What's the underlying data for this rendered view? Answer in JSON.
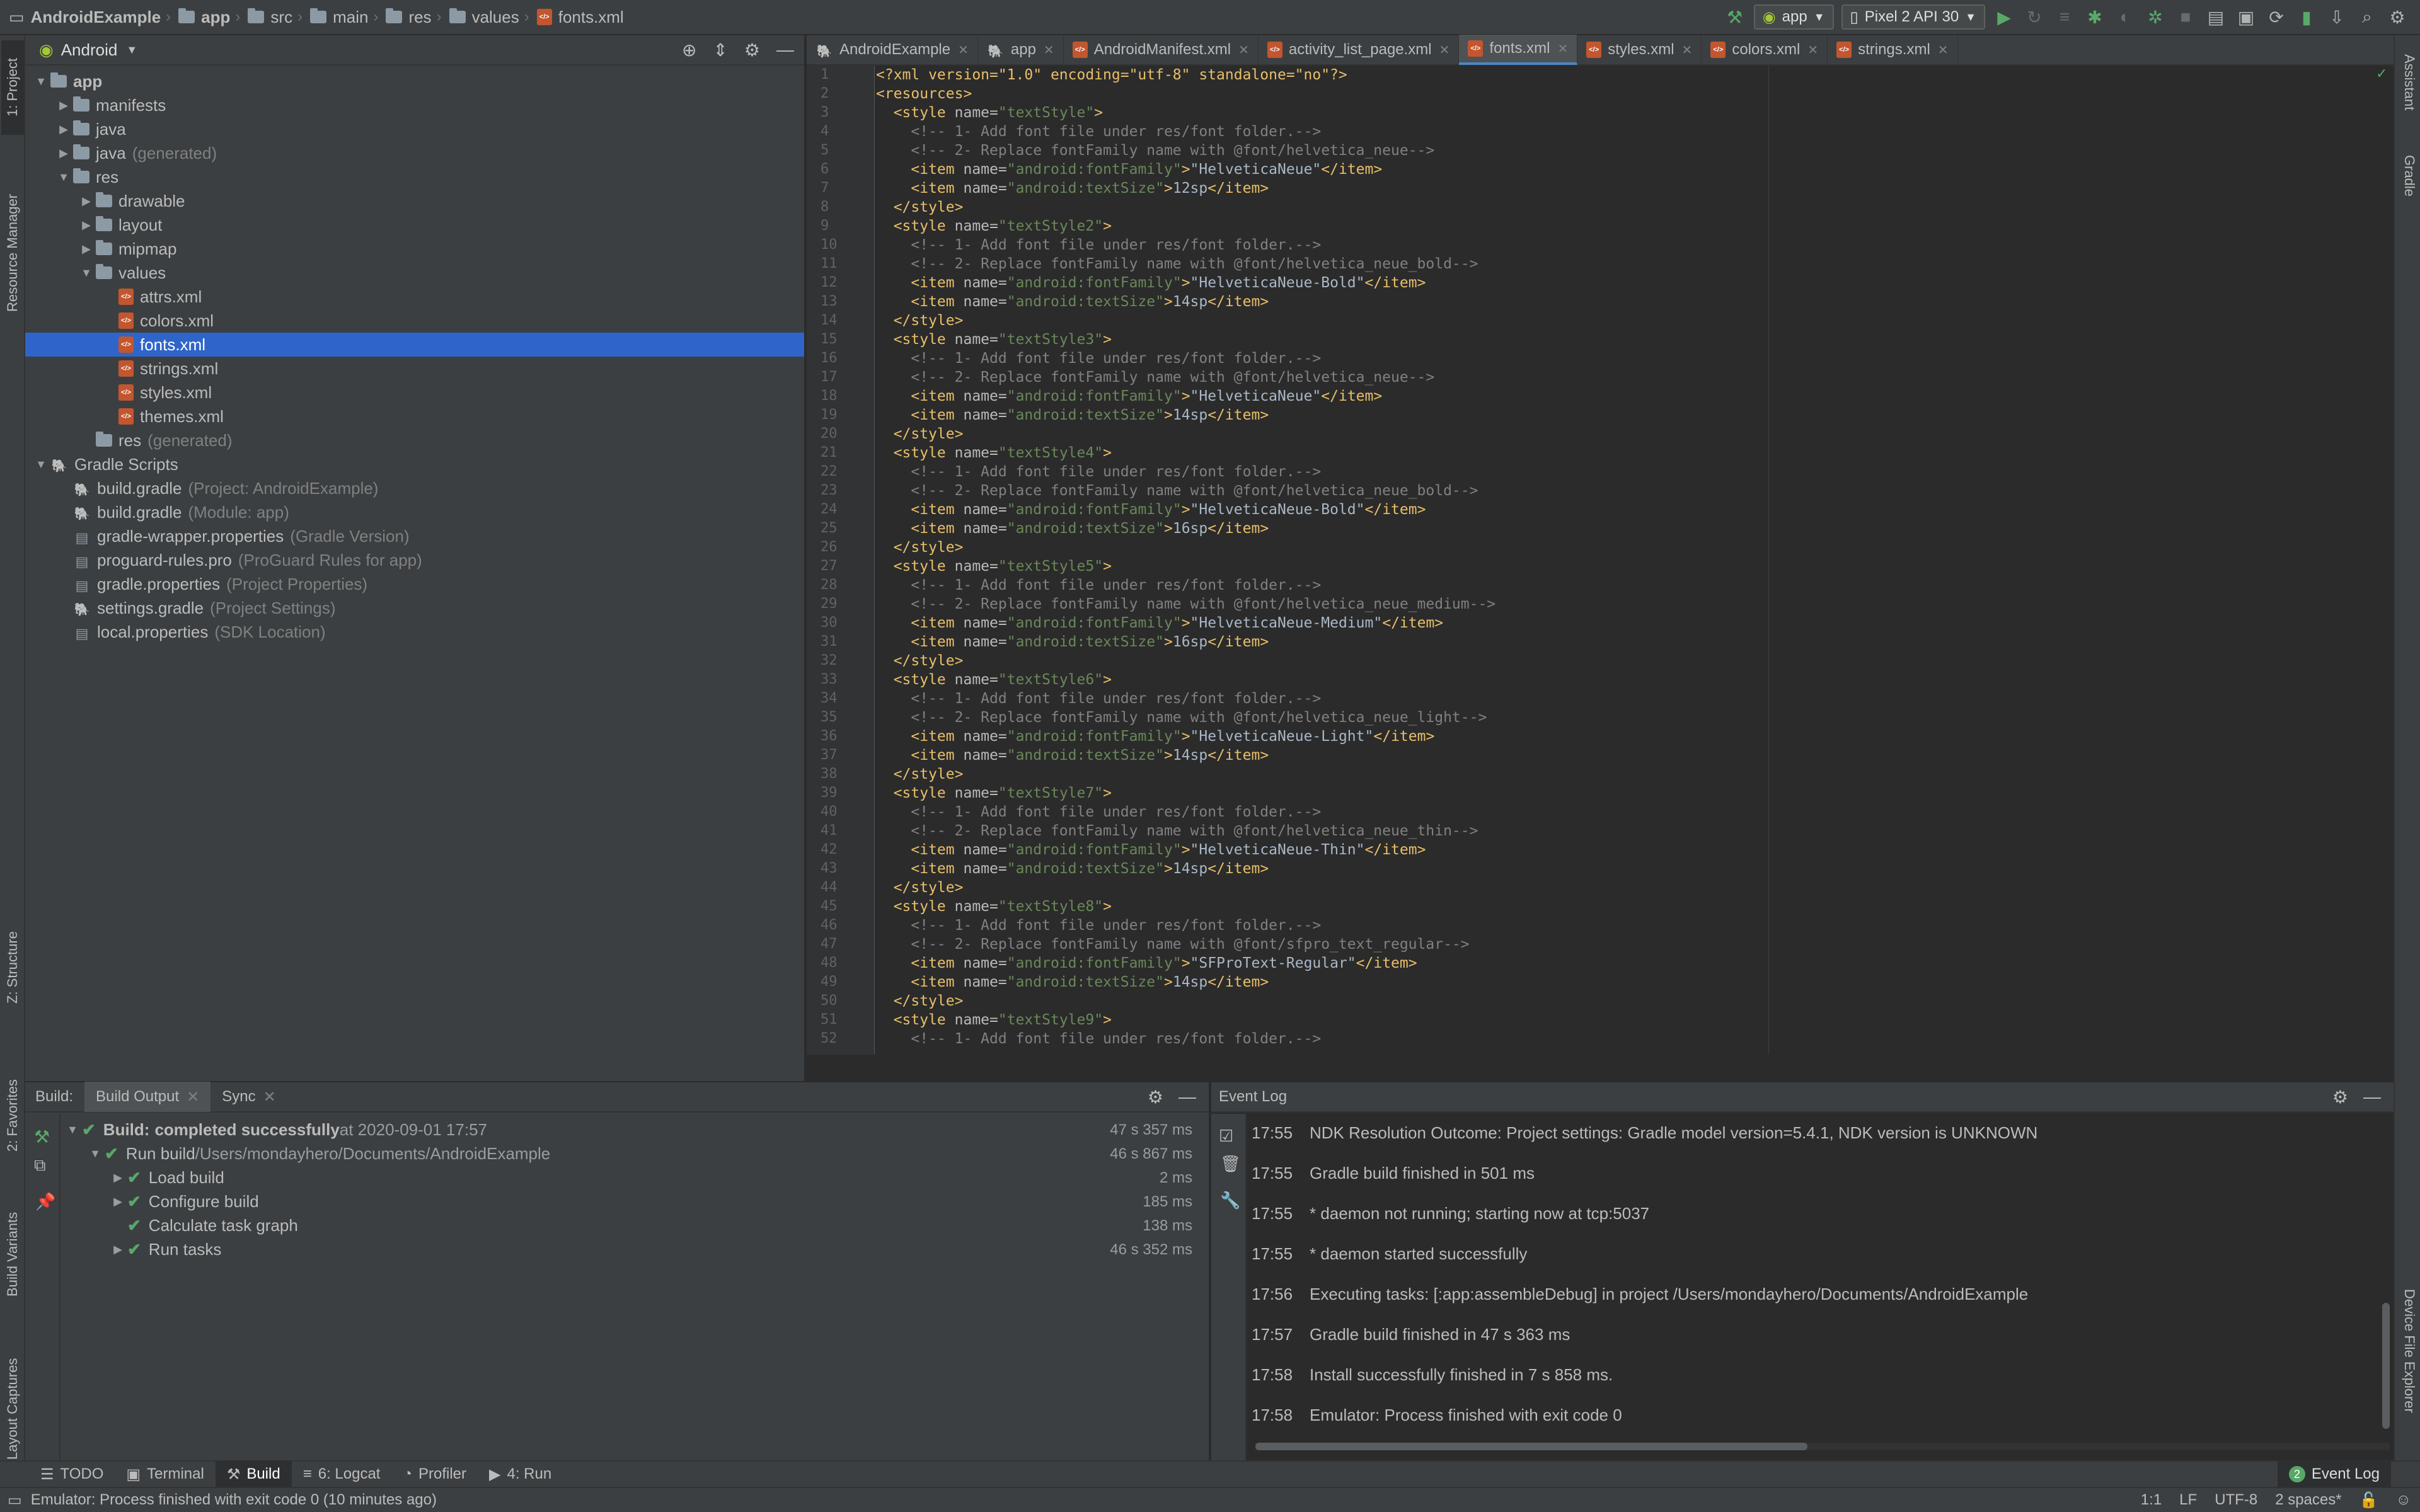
{
  "breadcrumbs": [
    "AndroidExample",
    "app",
    "src",
    "main",
    "res",
    "values",
    "fonts.xml"
  ],
  "run_config": "app",
  "device": "Pixel 2 API 30",
  "project_view": "Android",
  "left_stripe": {
    "project": "1: Project",
    "resource_manager": "Resource Manager",
    "structure": "Z: Structure",
    "favorites": "2: Favorites",
    "build_variants": "Build Variants",
    "layout_captures": "Layout Captures"
  },
  "right_stripe": {
    "assistant": "Assistant",
    "gradle": "Gradle",
    "device_file_explorer": "Device File Explorer"
  },
  "tree": [
    {
      "label": "app",
      "hint": "",
      "indent": 0,
      "arrow": "down",
      "icon": "folder-icon",
      "bold": true
    },
    {
      "label": "manifests",
      "hint": "",
      "indent": 1,
      "arrow": "right",
      "icon": "folder-icon"
    },
    {
      "label": "java",
      "hint": "",
      "indent": 1,
      "arrow": "right",
      "icon": "folder-icon"
    },
    {
      "label": "java",
      "hint": "(generated)",
      "indent": 1,
      "arrow": "right",
      "icon": "folder-icon"
    },
    {
      "label": "res",
      "hint": "",
      "indent": 1,
      "arrow": "down",
      "icon": "folder-icon"
    },
    {
      "label": "drawable",
      "hint": "",
      "indent": 2,
      "arrow": "right",
      "icon": "folder-icon"
    },
    {
      "label": "layout",
      "hint": "",
      "indent": 2,
      "arrow": "right",
      "icon": "folder-icon"
    },
    {
      "label": "mipmap",
      "hint": "",
      "indent": 2,
      "arrow": "right",
      "icon": "folder-icon"
    },
    {
      "label": "values",
      "hint": "",
      "indent": 2,
      "arrow": "down",
      "icon": "folder-icon"
    },
    {
      "label": "attrs.xml",
      "hint": "",
      "indent": 3,
      "arrow": "",
      "icon": "xml-file-icon"
    },
    {
      "label": "colors.xml",
      "hint": "",
      "indent": 3,
      "arrow": "",
      "icon": "xml-file-icon"
    },
    {
      "label": "fonts.xml",
      "hint": "",
      "indent": 3,
      "arrow": "",
      "icon": "xml-file-icon",
      "selected": true
    },
    {
      "label": "strings.xml",
      "hint": "",
      "indent": 3,
      "arrow": "",
      "icon": "xml-file-icon"
    },
    {
      "label": "styles.xml",
      "hint": "",
      "indent": 3,
      "arrow": "",
      "icon": "xml-file-icon"
    },
    {
      "label": "themes.xml",
      "hint": "",
      "indent": 3,
      "arrow": "",
      "icon": "xml-file-icon"
    },
    {
      "label": "res",
      "hint": "(generated)",
      "indent": 2,
      "arrow": "",
      "icon": "folder-icon"
    },
    {
      "label": "Gradle Scripts",
      "hint": "",
      "indent": 0,
      "arrow": "down",
      "icon": "gradle-icon"
    },
    {
      "label": "build.gradle",
      "hint": "(Project: AndroidExample)",
      "indent": 1,
      "arrow": "",
      "icon": "gradle-icon"
    },
    {
      "label": "build.gradle",
      "hint": "(Module: app)",
      "indent": 1,
      "arrow": "",
      "icon": "gradle-icon"
    },
    {
      "label": "gradle-wrapper.properties",
      "hint": "(Gradle Version)",
      "indent": 1,
      "arrow": "",
      "icon": "properties-icon"
    },
    {
      "label": "proguard-rules.pro",
      "hint": "(ProGuard Rules for app)",
      "indent": 1,
      "arrow": "",
      "icon": "properties-icon"
    },
    {
      "label": "gradle.properties",
      "hint": "(Project Properties)",
      "indent": 1,
      "arrow": "",
      "icon": "properties-icon"
    },
    {
      "label": "settings.gradle",
      "hint": "(Project Settings)",
      "indent": 1,
      "arrow": "",
      "icon": "gradle-icon"
    },
    {
      "label": "local.properties",
      "hint": "(SDK Location)",
      "indent": 1,
      "arrow": "",
      "icon": "properties-icon"
    }
  ],
  "editor_tabs": [
    {
      "label": "AndroidExample",
      "active": false
    },
    {
      "label": "app",
      "active": false
    },
    {
      "label": "AndroidManifest.xml",
      "active": false
    },
    {
      "label": "activity_list_page.xml",
      "active": false
    },
    {
      "label": "fonts.xml",
      "active": true
    },
    {
      "label": "styles.xml",
      "active": false
    },
    {
      "label": "colors.xml",
      "active": false
    },
    {
      "label": "strings.xml",
      "active": false
    }
  ],
  "code": {
    "header": "<?xml version=\"1.0\" encoding=\"utf-8\" standalone=\"no\"?>",
    "root_open": "<resources>",
    "comment1": "<!-- 1- Add font file under res/font folder.-->",
    "styles": [
      {
        "name": "textStyle",
        "font_res": "@font/helvetica_neue",
        "family": "HelveticaNeue",
        "size": "12sp"
      },
      {
        "name": "textStyle2",
        "font_res": "@font/helvetica_neue_bold",
        "family": "HelveticaNeue-Bold",
        "size": "14sp"
      },
      {
        "name": "textStyle3",
        "font_res": "@font/helvetica_neue",
        "family": "HelveticaNeue",
        "size": "14sp"
      },
      {
        "name": "textStyle4",
        "font_res": "@font/helvetica_neue_bold",
        "family": "HelveticaNeue-Bold",
        "size": "16sp"
      },
      {
        "name": "textStyle5",
        "font_res": "@font/helvetica_neue_medium",
        "family": "HelveticaNeue-Medium",
        "size": "16sp"
      },
      {
        "name": "textStyle6",
        "font_res": "@font/helvetica_neue_light",
        "family": "HelveticaNeue-Light",
        "size": "14sp"
      },
      {
        "name": "textStyle7",
        "font_res": "@font/helvetica_neue_thin",
        "family": "HelveticaNeue-Thin",
        "size": "14sp"
      },
      {
        "name": "textStyle8",
        "font_res": "@font/sfpro_text_regular",
        "family": "SFProText-Regular",
        "size": "14sp"
      },
      {
        "name": "textStyle9",
        "font_res": "",
        "family": "",
        "size": ""
      }
    ]
  },
  "build": {
    "label": "Build:",
    "tabs": [
      "Build Output",
      "Sync"
    ],
    "rows": [
      {
        "text": "Build:",
        "bold": true,
        "rest": "completed successfully",
        "extra": " at 2020-09-01 17:57",
        "time": "47 s 357 ms",
        "indent": 0,
        "arrow": "down"
      },
      {
        "text": "Run build",
        "rest": "",
        "extra": " /Users/mondayhero/Documents/AndroidExample",
        "time": "46 s 867 ms",
        "indent": 1,
        "arrow": "down"
      },
      {
        "text": "Load build",
        "rest": "",
        "extra": "",
        "time": "2 ms",
        "indent": 2,
        "arrow": "right"
      },
      {
        "text": "Configure build",
        "rest": "",
        "extra": "",
        "time": "185 ms",
        "indent": 2,
        "arrow": "right"
      },
      {
        "text": "Calculate task graph",
        "rest": "",
        "extra": "",
        "time": "138 ms",
        "indent": 2,
        "arrow": ""
      },
      {
        "text": "Run tasks",
        "rest": "",
        "extra": "",
        "time": "46 s 352 ms",
        "indent": 2,
        "arrow": "right"
      }
    ]
  },
  "event_log": {
    "title": "Event Log",
    "entries": [
      {
        "time": "17:55",
        "msg": "NDK Resolution Outcome: Project settings: Gradle model version=5.4.1, NDK version is UNKNOWN"
      },
      {
        "time": "17:55",
        "msg": "Gradle build finished in 501 ms"
      },
      {
        "time": "17:55",
        "msg": "* daemon not running; starting now at tcp:5037"
      },
      {
        "time": "17:55",
        "msg": "* daemon started successfully"
      },
      {
        "time": "17:56",
        "msg": "Executing tasks: [:app:assembleDebug] in project /Users/mondayhero/Documents/AndroidExample"
      },
      {
        "time": "17:57",
        "msg": "Gradle build finished in 47 s 363 ms"
      },
      {
        "time": "17:58",
        "msg": "Install successfully finished in 7 s 858 ms."
      },
      {
        "time": "17:58",
        "msg": "Emulator: Process finished with exit code 0"
      }
    ]
  },
  "bottom_tabs": [
    {
      "label": "TODO",
      "icon": "list-icon",
      "active": false
    },
    {
      "label": "Terminal",
      "icon": "terminal-icon",
      "active": false
    },
    {
      "label": "Build",
      "icon": "hammer-icon",
      "active": true
    },
    {
      "label": "6: Logcat",
      "icon": "logcat-icon",
      "active": false
    },
    {
      "label": "Profiler",
      "icon": "profiler-icon",
      "active": false
    },
    {
      "label": "4: Run",
      "icon": "run-icon",
      "active": false
    }
  ],
  "event_log_badge": {
    "count": "2",
    "label": "Event Log"
  },
  "status": {
    "message": "Emulator: Process finished with exit code 0 (10 minutes ago)",
    "position": "1:1",
    "line_sep": "LF",
    "encoding": "UTF-8",
    "indent": "2 spaces*"
  },
  "colors": {
    "accent": "#2f65ca",
    "success": "#59a869",
    "xml_tag": "#e8bf6a",
    "xml_value": "#6a8759"
  }
}
